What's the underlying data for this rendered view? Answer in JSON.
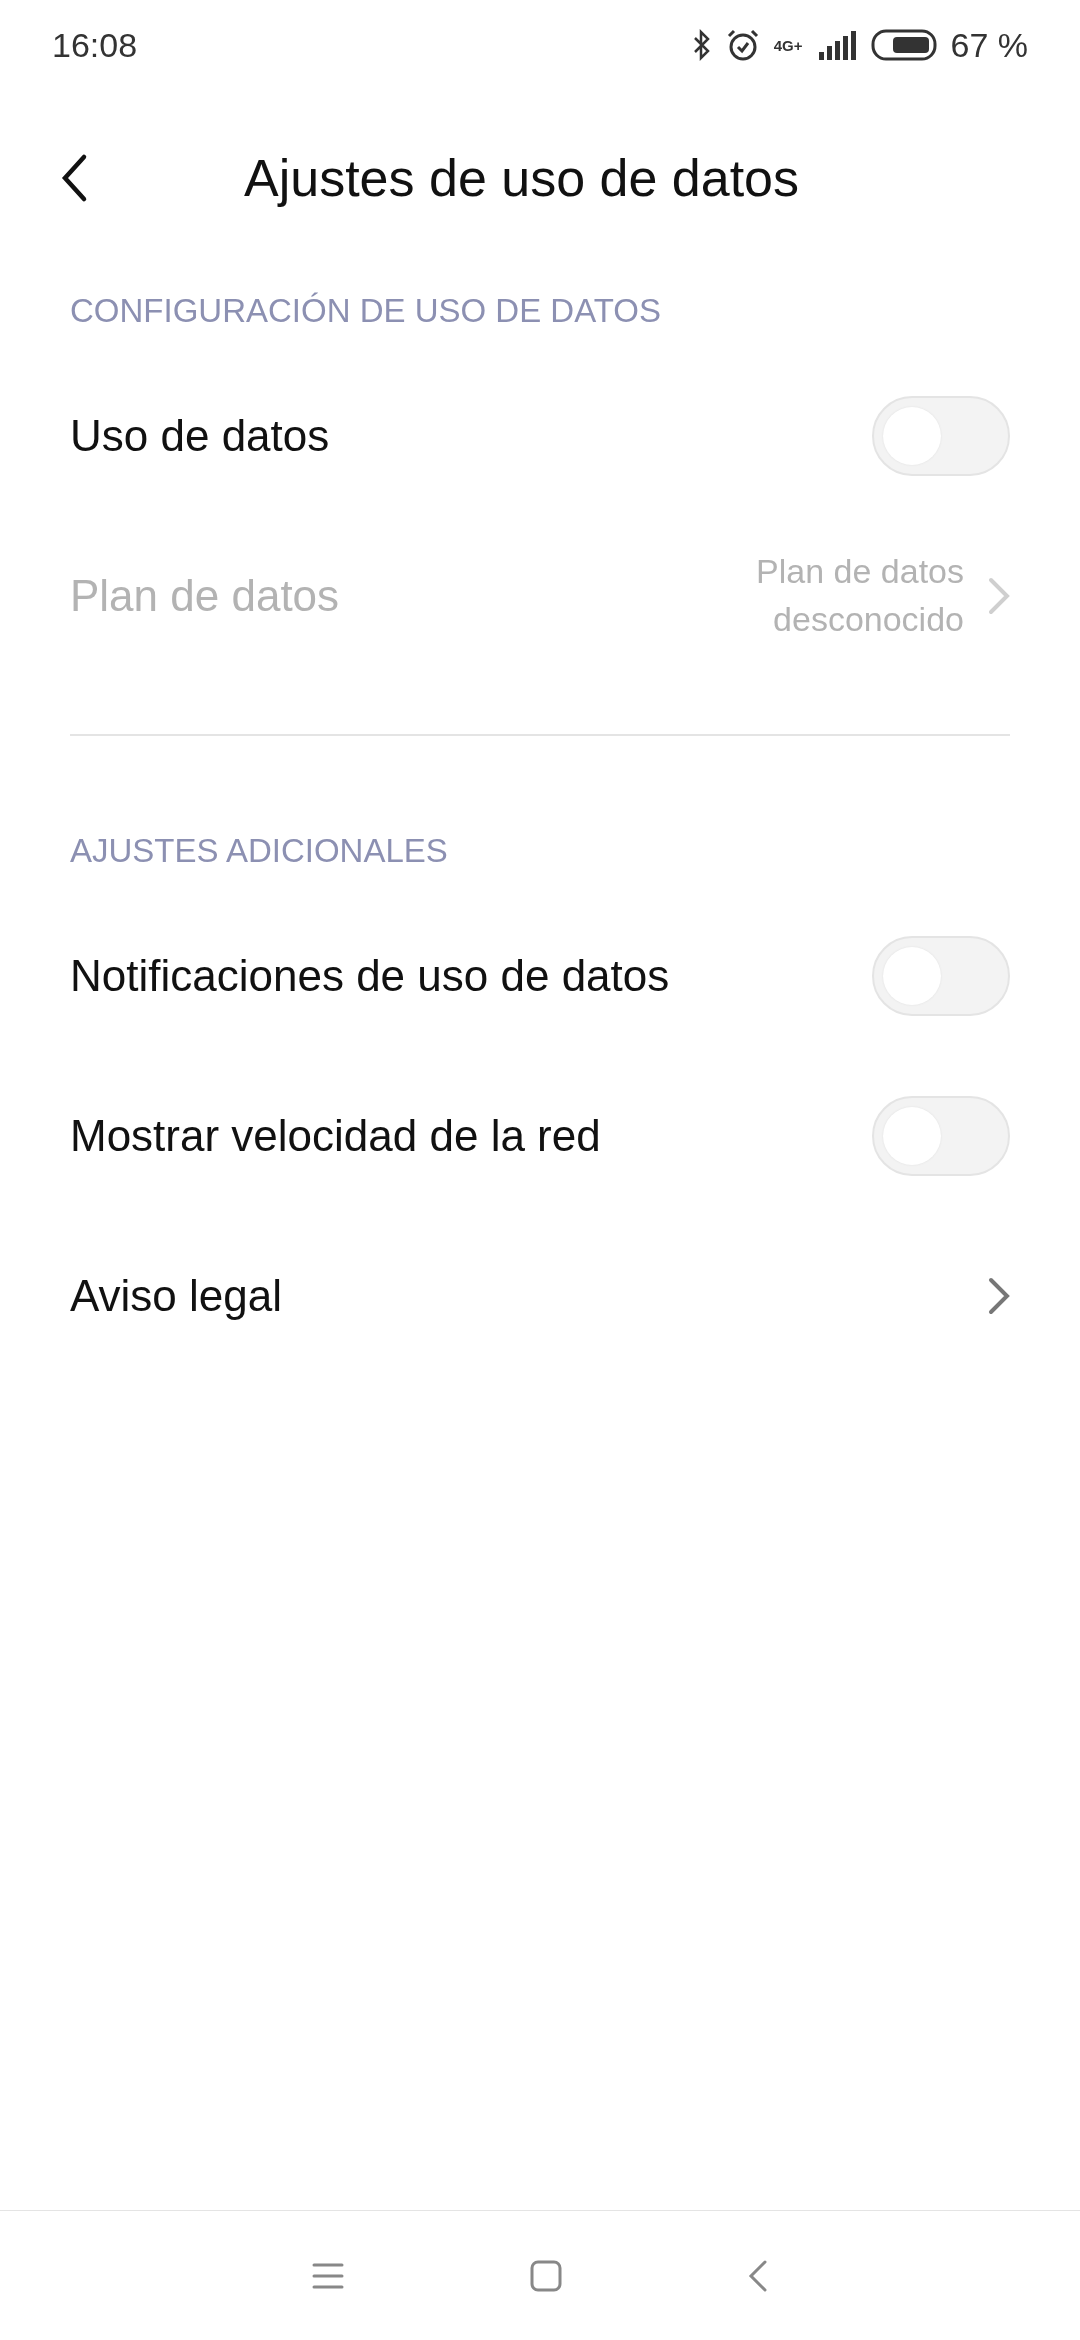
{
  "status_bar": {
    "time": "16:08",
    "network": "4G+",
    "battery": "67 %"
  },
  "header": {
    "title": "Ajustes de uso de datos"
  },
  "sections": [
    {
      "title": "CONFIGURACIÓN DE USO DE DATOS",
      "items": [
        {
          "kind": "toggle",
          "label": "Uso de datos",
          "on": false,
          "disabled": false
        },
        {
          "kind": "link",
          "label": "Plan de datos",
          "value": "Plan de datos desconocido",
          "disabled": true
        }
      ]
    },
    {
      "title": "AJUSTES ADICIONALES",
      "items": [
        {
          "kind": "toggle",
          "label": "Notificaciones de uso de datos",
          "on": false,
          "disabled": false
        },
        {
          "kind": "toggle",
          "label": "Mostrar velocidad de la red",
          "on": false,
          "disabled": false
        },
        {
          "kind": "link",
          "label": "Aviso legal",
          "disabled": false
        }
      ]
    }
  ]
}
